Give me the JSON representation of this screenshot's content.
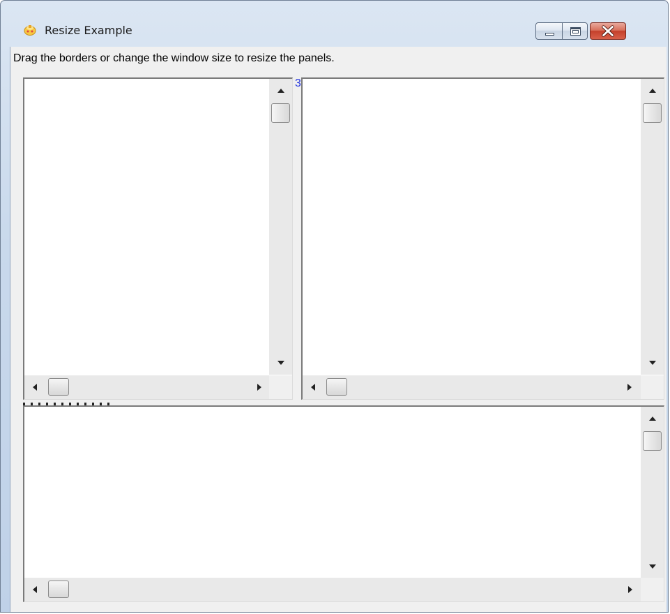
{
  "window": {
    "title": "Resize Example",
    "icon": "application-icon",
    "controls": {
      "minimize": "minimize-icon",
      "maximize": "maximize-icon",
      "close": "close-icon"
    }
  },
  "instruction": "Drag the borders or change the window size to resize the panels.",
  "vertical_splitter": {
    "glyph": "3"
  },
  "panels": [
    {
      "name": "top-left-panel"
    },
    {
      "name": "top-right-panel"
    },
    {
      "name": "bottom-panel"
    }
  ],
  "colors": {
    "close_button": "#c4402b",
    "splitter_glyph": "#2233dd",
    "title_bar": "#c9d9ec"
  }
}
